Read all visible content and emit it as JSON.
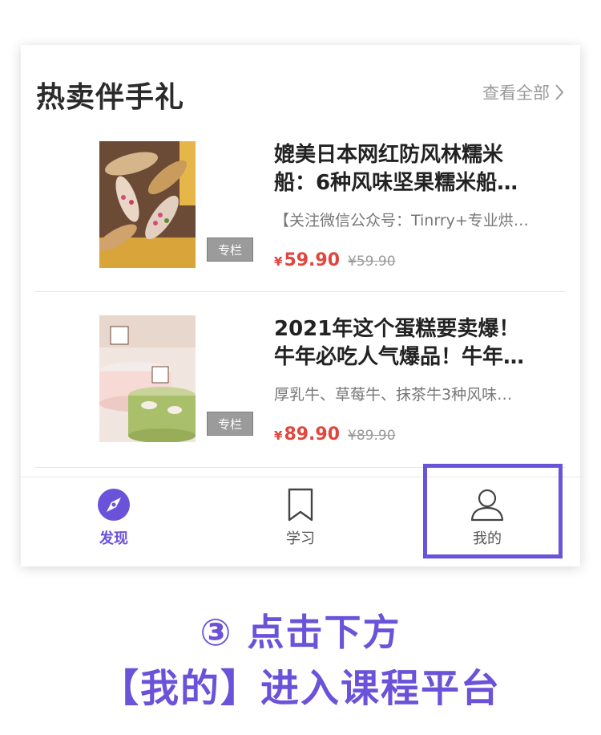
{
  "section": {
    "title": "热卖伴手礼",
    "view_all": "查看全部"
  },
  "products": [
    {
      "title_line1": "媲美日本网红防风林糯米",
      "title_line2": "船：6种风味坚果糯米船…",
      "desc": "【关注微信公众号：Tinrry+专业烘…",
      "tag": "专栏",
      "price_symbol": "¥",
      "price": "59.90",
      "original_price": "¥59.90"
    },
    {
      "title_line1": "2021年这个蛋糕要卖爆！",
      "title_line2": "牛年必吃人气爆品！牛年…",
      "desc": "厚乳牛、草莓牛、抹茶牛3种风味…",
      "tag": "专栏",
      "price_symbol": "¥",
      "price": "89.90",
      "original_price": "¥89.90"
    }
  ],
  "tabbar": {
    "discover": "发现",
    "study": "学习",
    "mine": "我的"
  },
  "colors": {
    "accent": "#6a52d9",
    "price": "#e0463d"
  },
  "caption": {
    "line1": "③ 点击下方",
    "line2": "【我的】进入课程平台"
  }
}
